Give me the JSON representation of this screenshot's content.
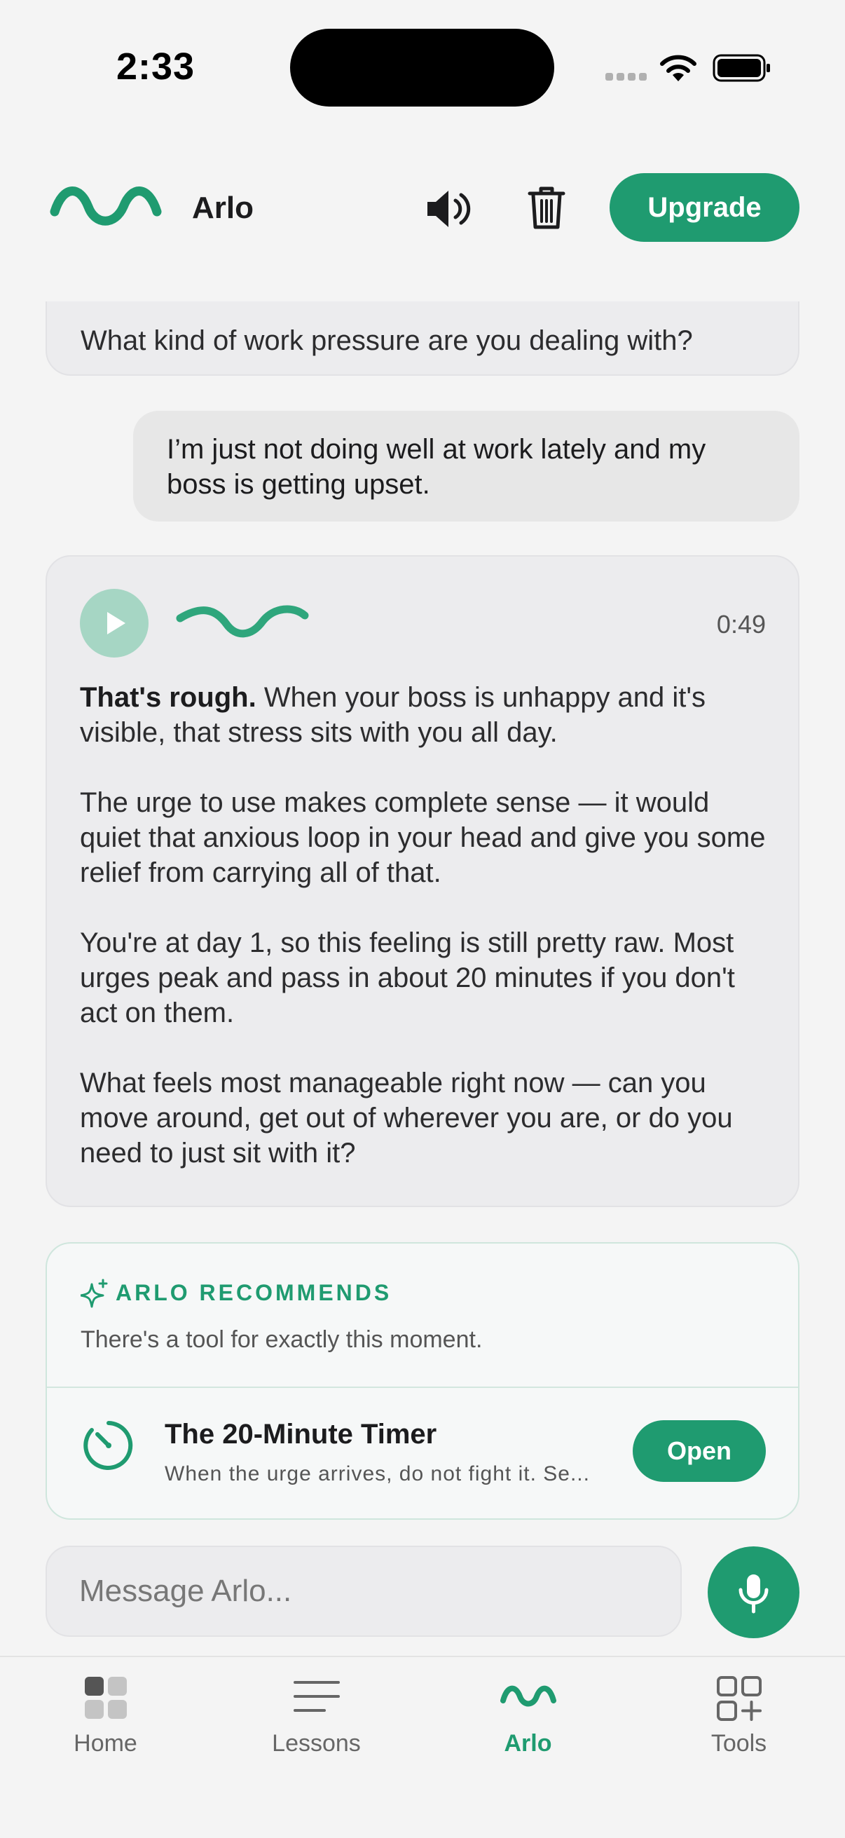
{
  "status_bar": {
    "time": "2:33"
  },
  "header": {
    "title": "Arlo",
    "upgrade_label": "Upgrade",
    "icons": [
      "arlo-logo-icon",
      "speaker-icon",
      "trash-icon"
    ]
  },
  "chat": {
    "previous_bot_message": "What kind of work pressure are you dealing with?",
    "user_message": "I’m just not doing well at work lately and my boss is getting upset.",
    "bot_message": {
      "duration": "0:49",
      "lead": "That's rough.",
      "paragraph_1_rest": " When your boss is unhappy and it's visible, that stress sits with you all day.",
      "paragraph_2": "The urge to use makes complete sense — it would quiet that anxious loop in your head and give you some relief from carrying all of that.",
      "paragraph_3": "You're at day 1, so this feeling is still pretty raw. Most urges peak and pass in about 20 minutes if you don't act on them.",
      "paragraph_4": "What feels most manageable right now — can you move around, get out of wherever you are, or do you need to just sit with it?"
    }
  },
  "recommendation": {
    "label": "ARLO RECOMMENDS",
    "subtitle": "There's a tool for exactly this moment.",
    "tool_title": "The 20-Minute Timer",
    "tool_description": "When the urge arrives, do not fight it. Se...",
    "open_label": "Open"
  },
  "composer": {
    "placeholder": "Message Arlo..."
  },
  "tabbar": {
    "tabs": [
      {
        "label": "Home"
      },
      {
        "label": "Lessons"
      },
      {
        "label": "Arlo"
      },
      {
        "label": "Tools"
      }
    ],
    "active": "Arlo"
  },
  "colors": {
    "accent": "#1f9b70",
    "accent_light": "#a6d6c4",
    "background": "#f4f4f4",
    "bubble": "#ececee"
  }
}
